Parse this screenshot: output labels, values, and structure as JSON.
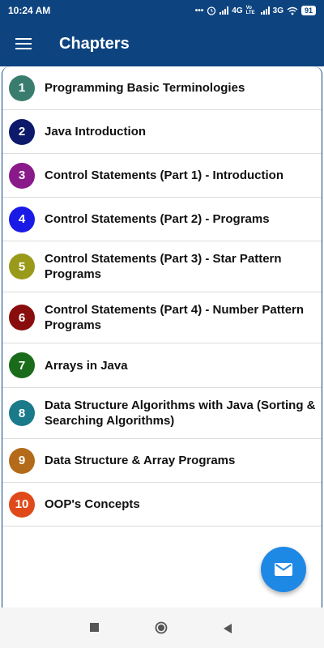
{
  "status_bar": {
    "time": "10:24 AM",
    "network_4g": "4G",
    "volte": "Vo LTE",
    "network_3g": "3G",
    "battery": "91",
    "icons": [
      "dots-icon",
      "alarm-icon",
      "signal-icon",
      "signal-icon",
      "wifi-icon",
      "battery-icon"
    ]
  },
  "app_bar": {
    "title": "Chapters",
    "menu_icon": "hamburger-icon"
  },
  "chapters": [
    {
      "number": "1",
      "title": "Programming Basic Terminologies",
      "color": "#3a7d6f"
    },
    {
      "number": "2",
      "title": "Java Introduction",
      "color": "#0d1a6b"
    },
    {
      "number": "3",
      "title": "Control Statements (Part 1) - Introduction",
      "color": "#8a1a8a"
    },
    {
      "number": "4",
      "title": "Control Statements (Part 2) - Programs",
      "color": "#1a1ae6"
    },
    {
      "number": "5",
      "title": "Control Statements (Part 3) - Star Pattern Programs",
      "color": "#9a9a1a"
    },
    {
      "number": "6",
      "title": "Control Statements (Part 4) - Number Pattern Programs",
      "color": "#8a0d0d"
    },
    {
      "number": "7",
      "title": "Arrays in Java",
      "color": "#1a6b1a"
    },
    {
      "number": "8",
      "title": "Data Structure Algorithms with Java (Sorting & Searching Algorithms)",
      "color": "#1a7a8a"
    },
    {
      "number": "9",
      "title": "Data Structure & Array Programs",
      "color": "#b36b1a"
    },
    {
      "number": "10",
      "title": "OOP's Concepts",
      "color": "#e04a1a"
    }
  ],
  "fab": {
    "icon": "mail-icon",
    "color": "#1e88e5"
  },
  "nav_bar": {
    "icons": [
      "recents-square-icon",
      "home-circle-icon",
      "back-triangle-icon"
    ]
  }
}
